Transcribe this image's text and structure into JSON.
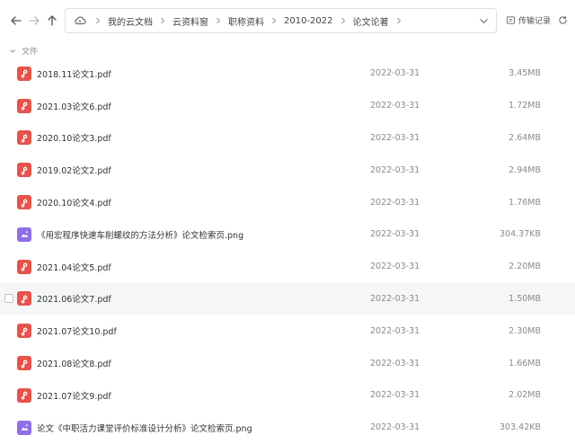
{
  "breadcrumb": {
    "items": [
      {
        "label": "我的云文档"
      },
      {
        "label": "云资料窗"
      },
      {
        "label": "职称资料"
      },
      {
        "label": "2010-2022"
      },
      {
        "label": "论文论著"
      }
    ]
  },
  "toolbar": {
    "history_label": "传输记录"
  },
  "section": {
    "label": "文件"
  },
  "files": [
    {
      "name": "2018.11论文1.pdf",
      "date": "2022-03-31",
      "size": "3.45MB",
      "type": "pdf"
    },
    {
      "name": "2021.03论文6.pdf",
      "date": "2022-03-31",
      "size": "1.72MB",
      "type": "pdf"
    },
    {
      "name": "2020.10论文3.pdf",
      "date": "2022-03-31",
      "size": "2.64MB",
      "type": "pdf"
    },
    {
      "name": "2019.02论文2.pdf",
      "date": "2022-03-31",
      "size": "2.94MB",
      "type": "pdf"
    },
    {
      "name": "2020.10论文4.pdf",
      "date": "2022-03-31",
      "size": "1.76MB",
      "type": "pdf"
    },
    {
      "name": "《用宏程序快速车削螺纹的方法分析》论文检索页.png",
      "date": "2022-03-31",
      "size": "304.37KB",
      "type": "png"
    },
    {
      "name": "2021.04论文5.pdf",
      "date": "2022-03-31",
      "size": "2.20MB",
      "type": "pdf"
    },
    {
      "name": "2021.06论文7.pdf",
      "date": "2022-03-31",
      "size": "1.50MB",
      "type": "pdf"
    },
    {
      "name": "2021.07论文10.pdf",
      "date": "2022-03-31",
      "size": "2.30MB",
      "type": "pdf"
    },
    {
      "name": "2021.08论文8.pdf",
      "date": "2022-03-31",
      "size": "1.66MB",
      "type": "pdf"
    },
    {
      "name": "2021.07论文9.pdf",
      "date": "2022-03-31",
      "size": "2.02MB",
      "type": "pdf"
    },
    {
      "name": "论文《中职活力课堂评价标准设计分析》论文检索页.png",
      "date": "2022-03-31",
      "size": "303.42KB",
      "type": "png"
    }
  ],
  "hovered_row": 7,
  "colors": {
    "pdf_icon": "#e5534b",
    "image_icon": "#8f6ee8",
    "hover_row": "#f5f6f8"
  },
  "icons": {
    "back": "arrow-left-icon",
    "forward": "arrow-right-icon",
    "up": "arrow-up-icon",
    "cloud": "cloud-icon",
    "dropdown": "chevron-down-icon",
    "history": "history-icon",
    "refresh": "refresh-icon",
    "pdf": "pdf-icon",
    "image": "image-icon"
  }
}
